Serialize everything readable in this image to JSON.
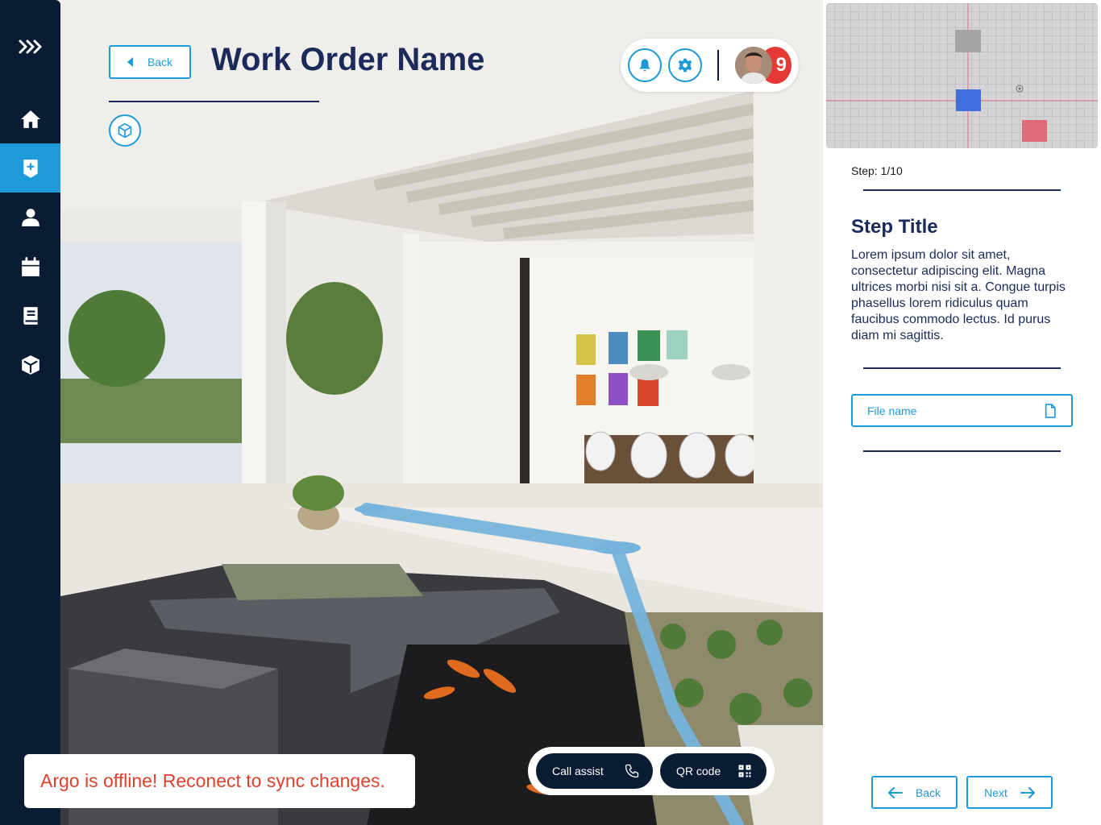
{
  "header": {
    "back_label": "Back",
    "title": "Work Order Name",
    "avatar_icon": "user-avatar",
    "notification_count": "9"
  },
  "sidebar": {
    "items": [
      {
        "icon": "home-icon",
        "active": false
      },
      {
        "icon": "work-order-icon",
        "active": true
      },
      {
        "icon": "user-icon",
        "active": false
      },
      {
        "icon": "calendar-icon",
        "active": false
      },
      {
        "icon": "manual-icon",
        "active": false
      },
      {
        "icon": "cube-icon",
        "active": false
      }
    ]
  },
  "toast": {
    "message": "Argo is offline! Reconect to sync changes."
  },
  "actions": {
    "call_assist_label": "Call assist",
    "qr_code_label": "QR code"
  },
  "panel": {
    "step_count": "Step: 1/10",
    "step_title": "Step Title",
    "step_description": "Lorem ipsum dolor sit amet, consectetur adipiscing elit. Magna ultrices morbi nisi sit a. Congue turpis phasellus lorem ridiculus quam faucibus commodo lectus. Id purus diam mi sagittis.",
    "file_placeholder": "File name",
    "back_label": "Back",
    "next_label": "Next"
  },
  "colors": {
    "sidebar_bg": "#0a1c33",
    "accent": "#1e9ad8",
    "title": "#1b2a5a",
    "error": "#e0402c",
    "badge": "#e53935"
  }
}
